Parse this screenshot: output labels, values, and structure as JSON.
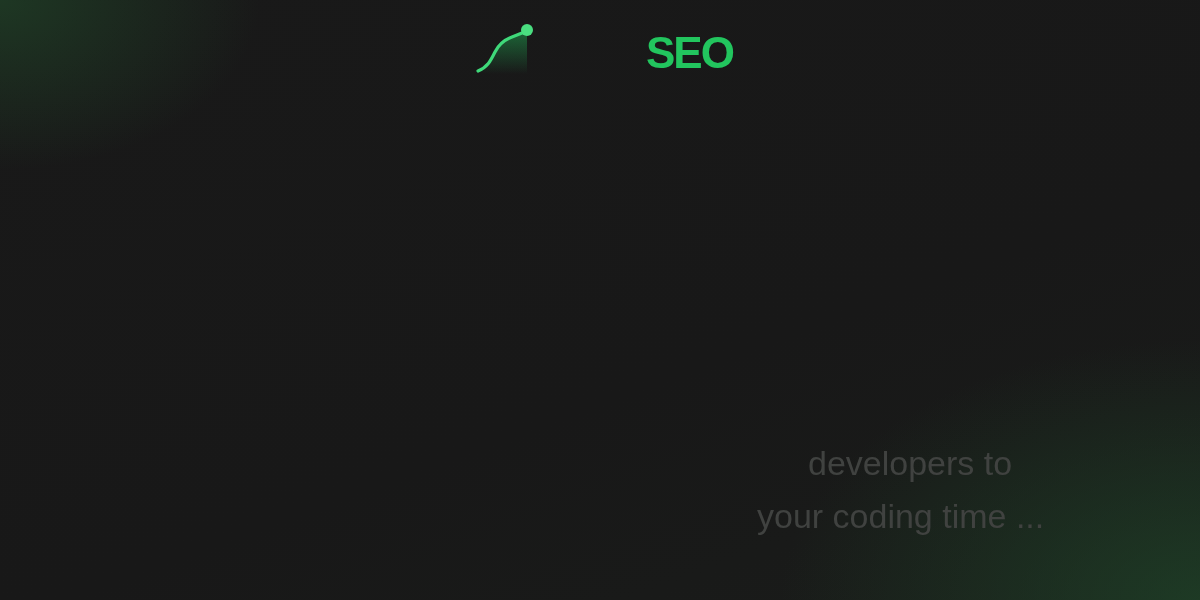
{
  "logo": {
    "suffix": "SEO"
  },
  "tagline": {
    "lines": [
      "developers to",
      "your coding time ..."
    ]
  }
}
